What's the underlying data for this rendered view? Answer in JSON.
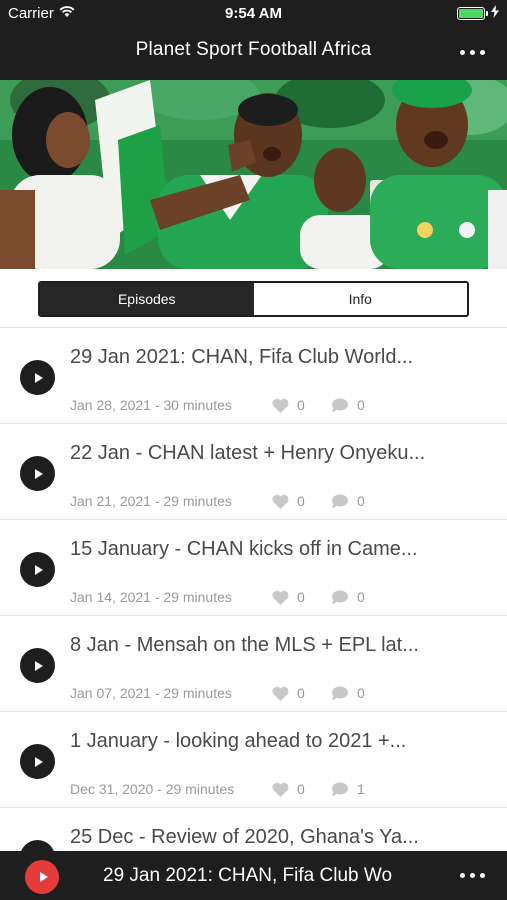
{
  "status_bar": {
    "carrier": "Carrier",
    "time": "9:54 AM"
  },
  "nav": {
    "title": "Planet Sport Football Africa"
  },
  "segments": {
    "episodes": "Episodes",
    "info": "Info",
    "selected": "Episodes"
  },
  "episodes": [
    {
      "title": "29 Jan 2021:  CHAN, Fifa Club World...",
      "meta": "Jan 28, 2021 - 30 minutes",
      "likes": "0",
      "comments": "0"
    },
    {
      "title": "22 Jan - CHAN latest + Henry Onyeku...",
      "meta": "Jan 21, 2021 - 29 minutes",
      "likes": "0",
      "comments": "0"
    },
    {
      "title": "15 January - CHAN kicks off in Came...",
      "meta": "Jan 14, 2021 - 29 minutes",
      "likes": "0",
      "comments": "0"
    },
    {
      "title": "8 Jan - Mensah on the MLS + EPL lat...",
      "meta": "Jan 07, 2021 - 29 minutes",
      "likes": "0",
      "comments": "0"
    },
    {
      "title": "1 January - looking ahead to 2021 +...",
      "meta": "Dec 31, 2020 - 29 minutes",
      "likes": "0",
      "comments": "1"
    },
    {
      "title": "25 Dec - Review of 2020, Ghana's Ya..."
    }
  ],
  "player": {
    "now_playing": "29 Jan 2021:  CHAN, Fifa Club Wo"
  },
  "colors": {
    "bar": "#1e1e1e",
    "accent_play": "#e53b3b",
    "battery": "#4cd964",
    "text_title": "#4a4a4a",
    "text_meta": "#9a9a9a"
  }
}
